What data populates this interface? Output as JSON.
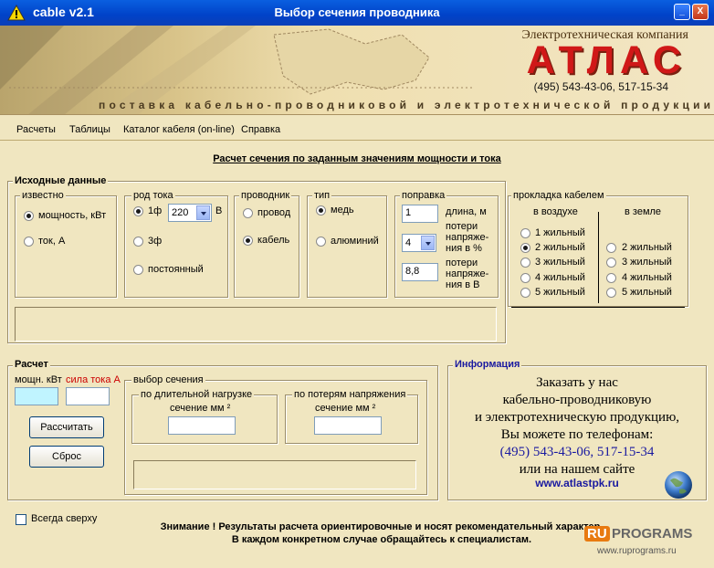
{
  "titlebar": {
    "app_name": "cable v2.1",
    "title": "Выбор сечения проводника",
    "minimize": "_",
    "close": "X"
  },
  "banner": {
    "company": "Электротехническая компания",
    "logo": "АТЛАС",
    "phones": "(495) 543-43-06, 517-15-34",
    "slogan": "поставка кабельно-проводниковой и электротехнической продукции"
  },
  "menu": {
    "items": [
      "Расчеты",
      "Таблицы",
      "Каталог кабеля (on-line)",
      "Справка"
    ]
  },
  "heading": "Расчет сечения по заданным значениям мощности и тока",
  "source": {
    "legend": "Исходные данные",
    "known": {
      "legend": "известно",
      "options": [
        "мощность, кВт",
        "ток, А"
      ],
      "selected": 0
    },
    "current_type": {
      "legend": "род тока",
      "options": [
        "1ф",
        "3ф",
        "постоянный"
      ],
      "selected": 0,
      "voltage": "220",
      "voltage_unit": "В"
    },
    "conductor": {
      "legend": "проводник",
      "options": [
        "провод",
        "кабель"
      ],
      "selected": 1
    },
    "type": {
      "legend": "тип",
      "options": [
        "медь",
        "алюминий"
      ],
      "selected": 0
    },
    "correction": {
      "legend": "поправка",
      "length_value": "1",
      "length_label": "длина, м",
      "loss_percent_value": "4",
      "loss_percent_label": "потери напряже-ния в %",
      "loss_volt_value": "8,8",
      "loss_volt_label": "потери напряже-ния в В"
    },
    "laying": {
      "legend": "прокладка кабелем",
      "air": {
        "title": "в воздухе",
        "options": [
          "1 жильный",
          "2 жильный",
          "3 жильный",
          "4 жильный",
          "5 жильный"
        ],
        "selected": 1
      },
      "ground": {
        "title": "в земле",
        "options": [
          "2 жильный",
          "3 жильный",
          "4 жильный",
          "5 жильный"
        ]
      }
    }
  },
  "calc": {
    "legend": "Расчет",
    "power_label": "мощн. кВт",
    "current_label": "сила тока А",
    "current_color": "#cc0000",
    "power_value": "",
    "current_value": "",
    "calculate": "Рассчитать",
    "reset": "Сброс",
    "section_choice": {
      "legend": "выбор сечения",
      "long_load": {
        "legend": "по длительной нагрузке",
        "label": "сечение мм ²",
        "value": ""
      },
      "voltage_loss": {
        "legend": "по потерям напряжения",
        "label": "сечение мм ²",
        "value": ""
      }
    }
  },
  "info": {
    "legend": "Информация",
    "lines": [
      "Заказать у нас",
      "кабельно-проводниковую",
      "и электротехническую продукцию,",
      "Вы можете по телефонам:"
    ],
    "phones": "(495) 543-43-06, 517-15-34",
    "site_line": "или на нашем сайте",
    "site": "www.atlastpk.ru",
    "globe_icon": "globe-icon"
  },
  "always_on_top": {
    "label": "Всегда сверху",
    "checked": false
  },
  "footer": {
    "line1": "Знимание !  Результаты расчета ориентировочные и носят рекомендательный характер.",
    "line2": "В каждом конкретном случае обращайтесь к специалистам."
  },
  "watermark": {
    "ru": "RU",
    "programs": "PROGRAMS",
    "url": "www.ruprograms.ru"
  },
  "colors": {
    "accent": "#0042c8",
    "background": "#f0e6c0",
    "logo_red": "#d01818",
    "info_blue": "#1a1aa0"
  }
}
